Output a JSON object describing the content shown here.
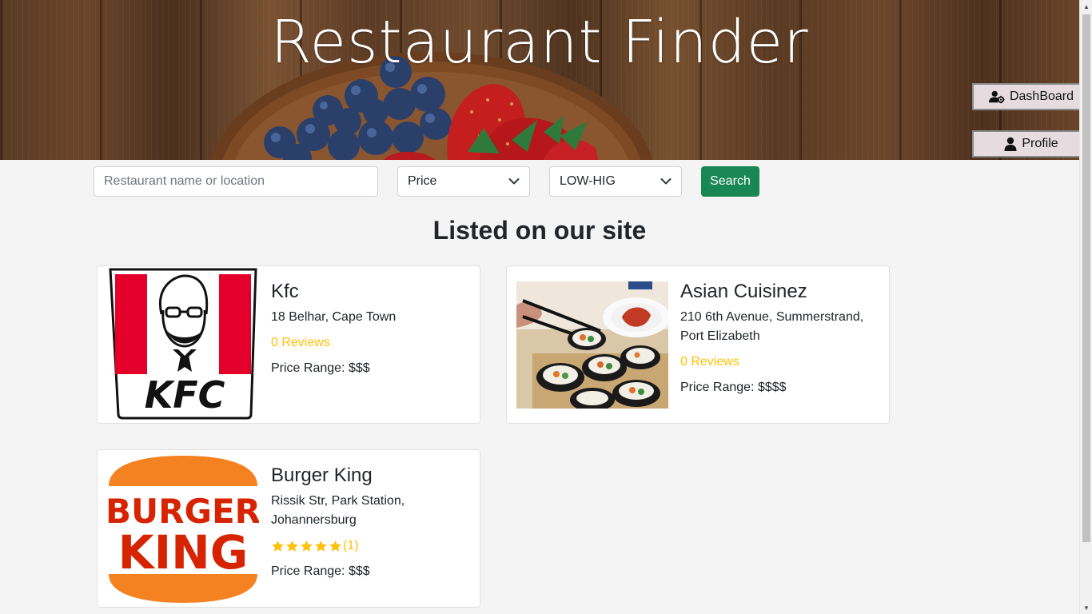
{
  "header": {
    "title": "Restaurant Finder",
    "dashboard_label": "DashBoard",
    "profile_label": "Profile"
  },
  "search": {
    "placeholder": "Restaurant name or location",
    "value": "",
    "price_select": "Price",
    "order_select": "LOW-HIG",
    "button_label": "Search"
  },
  "listing": {
    "heading": "Listed on our site",
    "restaurants": [
      {
        "name": "Kfc",
        "address": "18 Belhar, Cape Town",
        "reviews": "0 Reviews",
        "price": "Price Range: $$$",
        "logo_text": "KFC"
      },
      {
        "name": "Asian Cuisinez",
        "address": "210 6th Avenue, Summerstrand, Port Elizabeth",
        "reviews": "0 Reviews",
        "price": "Price Range: $$$$"
      },
      {
        "name": "Burger King",
        "address": "Rissik Str, Park Station, Johannersburg",
        "rating": 5,
        "reviews": "(1)",
        "price": "Price Range: $$$",
        "logo_line1": "BURGER",
        "logo_line2": "KING"
      }
    ]
  },
  "colors": {
    "accent_green": "#198754",
    "review_yellow": "#ffc107",
    "kfc_red": "#e4002b",
    "bk_orange": "#f58220",
    "bk_red": "#d62300"
  }
}
